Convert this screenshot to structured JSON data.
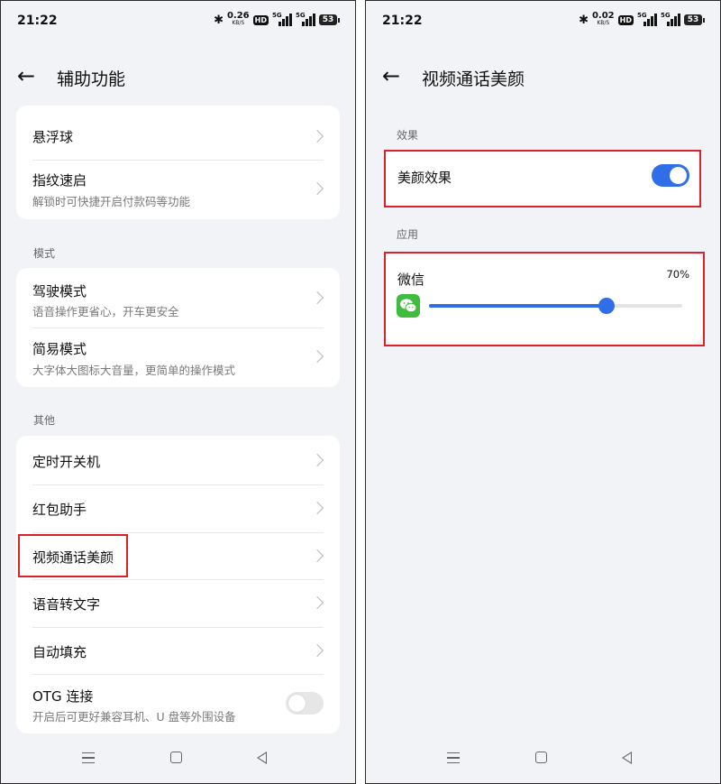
{
  "status_left": {
    "time": "21:22",
    "speed": "0.26",
    "speed_unit": "KB/S",
    "hd": "HD",
    "net1": "5G",
    "net2": "5G",
    "battery": "53"
  },
  "status_right": {
    "time": "21:22",
    "speed": "0.02",
    "speed_unit": "KB/S",
    "hd": "HD",
    "net1": "5G",
    "net2": "5G",
    "battery": "53"
  },
  "left_screen": {
    "title": "辅助功能",
    "top_group": [
      {
        "title": "悬浮球",
        "subtitle": ""
      },
      {
        "title": "指纹速启",
        "subtitle": "解锁时可快捷开启付款码等功能"
      }
    ],
    "mode_section": {
      "label": "模式",
      "items": [
        {
          "title": "驾驶模式",
          "subtitle": "语音操作更省心，开车更安全"
        },
        {
          "title": "简易模式",
          "subtitle": "大字体大图标大音量，更简单的操作模式"
        }
      ]
    },
    "other_section": {
      "label": "其他",
      "items": [
        {
          "title": "定时开关机"
        },
        {
          "title": "红包助手"
        },
        {
          "title": "视频通话美颜"
        },
        {
          "title": "语音转文字"
        },
        {
          "title": "自动填充"
        }
      ],
      "otg": {
        "title": "OTG 连接",
        "subtitle": "开启后可更好兼容耳机、U 盘等外围设备",
        "enabled": false
      }
    }
  },
  "right_screen": {
    "title": "视频通话美颜",
    "effect_section": {
      "label": "效果",
      "toggle_label": "美颜效果",
      "enabled": true
    },
    "app_section": {
      "label": "应用",
      "app_name": "微信",
      "level_text": "70%",
      "level": 70
    }
  },
  "colors": {
    "accent": "#2f6ee7",
    "highlight": "#d8232a",
    "wechat": "#3fbc3f"
  },
  "icons": [
    "back-arrow-icon",
    "chevron-right-icon",
    "wechat-icon",
    "bluetooth-icon",
    "signal-icon",
    "battery-icon",
    "nav-menu-icon",
    "nav-home-icon",
    "nav-back-icon"
  ]
}
